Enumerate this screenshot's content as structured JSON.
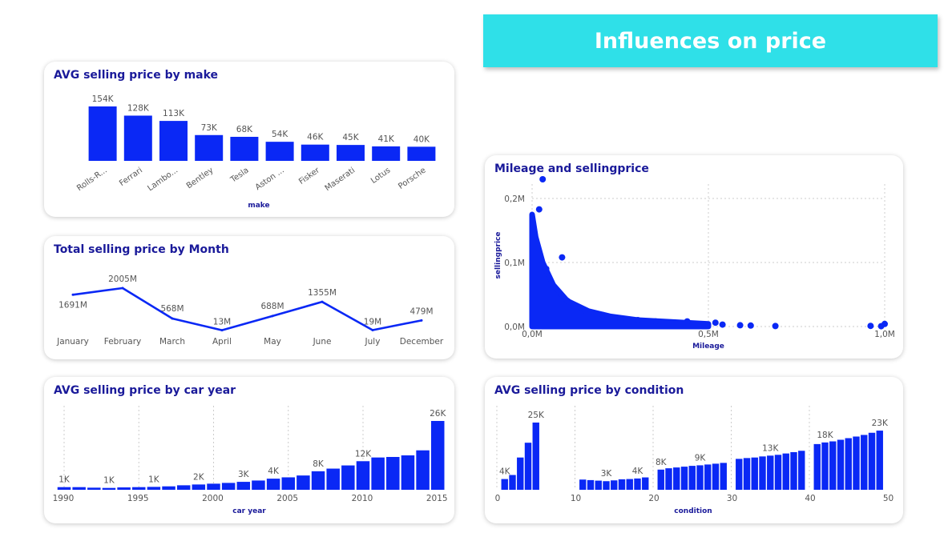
{
  "header": {
    "title": "Influences on price"
  },
  "colors": {
    "bar": "#0a28f5",
    "title_text": "#1a1a9a",
    "label_text": "#555555",
    "banner": "#2fe0e8",
    "grid": "#cccccc"
  },
  "chart_data": [
    {
      "id": "make",
      "type": "bar",
      "title": "AVG selling price by make",
      "xlabel": "make",
      "categories": [
        "Rolls-R...",
        "Ferrari",
        "Lambo...",
        "Bentley",
        "Tesla",
        "Aston ...",
        "Fisker",
        "Maserati",
        "Lotus",
        "Porsche"
      ],
      "values": [
        154000,
        128000,
        113000,
        73000,
        68000,
        54000,
        46000,
        45000,
        41000,
        40000
      ],
      "labels": [
        "154K",
        "128K",
        "113K",
        "73K",
        "68K",
        "54K",
        "46K",
        "45K",
        "41K",
        "40K"
      ]
    },
    {
      "id": "month",
      "type": "line",
      "title": "Total selling price by Month",
      "categories": [
        "January",
        "February",
        "March",
        "April",
        "May",
        "June",
        "July",
        "December"
      ],
      "values": [
        1691,
        2005,
        568,
        13,
        688,
        1355,
        19,
        479
      ],
      "labels": [
        "1691M",
        "2005M",
        "568M",
        "13M",
        "688M",
        "1355M",
        "19M",
        "479M"
      ]
    },
    {
      "id": "year",
      "type": "bar",
      "title": "AVG selling price by car year",
      "xlabel": "car year",
      "x": [
        1990,
        1991,
        1992,
        1993,
        1994,
        1995,
        1996,
        1997,
        1998,
        1999,
        2000,
        2001,
        2002,
        2003,
        2004,
        2005,
        2006,
        2007,
        2008,
        2009,
        2010,
        2011,
        2012,
        2013,
        2014,
        2015
      ],
      "values": [
        1000,
        1000,
        800,
        700,
        900,
        1000,
        1100,
        1300,
        1700,
        2000,
        2300,
        2600,
        3000,
        3500,
        4200,
        4700,
        5400,
        7000,
        8000,
        9200,
        10800,
        12200,
        12400,
        13000,
        14900,
        26000
      ],
      "labels": [
        "1K",
        "1K",
        "1K",
        "2K",
        "3K",
        "4K",
        "8K",
        "12K",
        "26K"
      ],
      "label_index": [
        0,
        3,
        6,
        9,
        12,
        14,
        17,
        20,
        25
      ],
      "ticks": [
        1990,
        1995,
        2000,
        2005,
        2010,
        2015
      ]
    },
    {
      "id": "condition",
      "type": "bar",
      "title": "AVG selling price by condition",
      "xlabel": "condition",
      "x": [
        1,
        2,
        3,
        4,
        5,
        11,
        12,
        13,
        14,
        15,
        16,
        17,
        18,
        19,
        21,
        22,
        23,
        24,
        25,
        26,
        27,
        28,
        29,
        31,
        32,
        33,
        34,
        35,
        36,
        37,
        38,
        39,
        41,
        42,
        43,
        44,
        45,
        46,
        47,
        48,
        49
      ],
      "values": [
        4000,
        5500,
        12000,
        17500,
        25000,
        3800,
        3600,
        3400,
        3200,
        3500,
        3900,
        4000,
        4200,
        4600,
        7500,
        8000,
        8300,
        8600,
        8900,
        9100,
        9400,
        9700,
        10000,
        11500,
        11800,
        12000,
        12400,
        12700,
        13000,
        13500,
        14000,
        14500,
        17000,
        17600,
        18000,
        18600,
        19200,
        19800,
        20400,
        21200,
        22000
      ],
      "labels": [
        "4K",
        "25K",
        "3K",
        "4K",
        "8K",
        "9K",
        "13K",
        "18K",
        "23K"
      ],
      "label_index": [
        0,
        4,
        8,
        12,
        14,
        19,
        27,
        33,
        40
      ],
      "ticks": [
        0,
        10,
        20,
        30,
        40,
        50
      ]
    },
    {
      "id": "mileage",
      "type": "scatter",
      "title": "Mileage and sellingprice",
      "xlabel": "Mileage",
      "ylabel": "sellingprice",
      "xlim": [
        0,
        1000000
      ],
      "ylim": [
        0,
        230000
      ],
      "xticks": [
        "0,0M",
        "0,5M",
        "1,0M"
      ],
      "yticks": [
        "0,0M",
        "0,1M",
        "0,2M"
      ],
      "points": [
        [
          30000,
          230000
        ],
        [
          20000,
          183000
        ],
        [
          85000,
          108000
        ],
        [
          40000,
          90000
        ],
        [
          60000,
          60000
        ],
        [
          100000,
          40000
        ],
        [
          150000,
          25000
        ],
        [
          200000,
          18000
        ],
        [
          250000,
          12000
        ],
        [
          300000,
          10000
        ],
        [
          350000,
          8000
        ],
        [
          440000,
          8000
        ],
        [
          520000,
          6000
        ],
        [
          540000,
          3000
        ],
        [
          590000,
          2000
        ],
        [
          620000,
          1500
        ],
        [
          690000,
          800
        ],
        [
          960000,
          1000
        ],
        [
          990000,
          500
        ],
        [
          1000000,
          4000
        ]
      ],
      "density_band": [
        [
          0,
          175000
        ],
        [
          10000,
          140000
        ],
        [
          30000,
          100000
        ],
        [
          60000,
          65000
        ],
        [
          100000,
          40000
        ],
        [
          160000,
          24000
        ],
        [
          220000,
          16000
        ],
        [
          300000,
          10000
        ],
        [
          400000,
          7000
        ],
        [
          500000,
          4000
        ]
      ]
    }
  ]
}
